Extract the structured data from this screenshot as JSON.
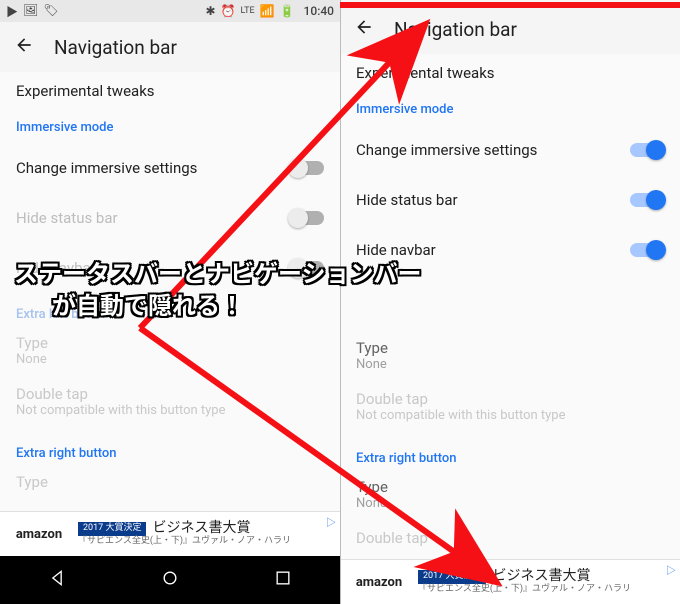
{
  "status": {
    "clock": "10:40",
    "icons": {
      "play": "▶",
      "image": "🖼",
      "tag": "🏷",
      "bt": "✱",
      "alarm": "⏰",
      "lte": "LTE",
      "signal": "📶",
      "battery": "🔋"
    }
  },
  "left": {
    "title": "Navigation bar",
    "heading": "Experimental tweaks",
    "section1": "Immersive mode",
    "s1": {
      "label": "Change immersive settings",
      "on": false
    },
    "s2": {
      "label": "Hide status bar",
      "on": false
    },
    "s3": {
      "label": "Hide navbar",
      "on": false
    },
    "section2": "Extra left button",
    "type": {
      "label": "Type",
      "value": "None"
    },
    "dbl": {
      "label": "Double tap",
      "value": "Not compatible with this button type"
    },
    "section3": "Extra right button",
    "type2": {
      "label": "Type"
    }
  },
  "right": {
    "title": "Navigation bar",
    "heading": "Experimental tweaks",
    "section1": "Immersive mode",
    "s1": {
      "label": "Change immersive settings",
      "on": true
    },
    "s2": {
      "label": "Hide status bar",
      "on": true
    },
    "s3": {
      "label": "Hide navbar",
      "on": true
    },
    "type": {
      "label": "Type",
      "value": "None"
    },
    "dbl": {
      "label": "Double tap",
      "value": "Not compatible with this button type"
    },
    "section3": "Extra right button",
    "type2": {
      "label": "Type",
      "value": "None"
    },
    "dbl2": {
      "label": "Double tap"
    }
  },
  "ad": {
    "logo": "amazon",
    "badge": "2017 大賞決定",
    "big": "ビジネス書大賞",
    "small": "『サピエンス全史(上・下)』ユヴァル・ノア・ハラリ"
  },
  "overlay": {
    "line1": "ステータスバーとナビゲーションバー",
    "line2": "が自動で隠れる！"
  }
}
